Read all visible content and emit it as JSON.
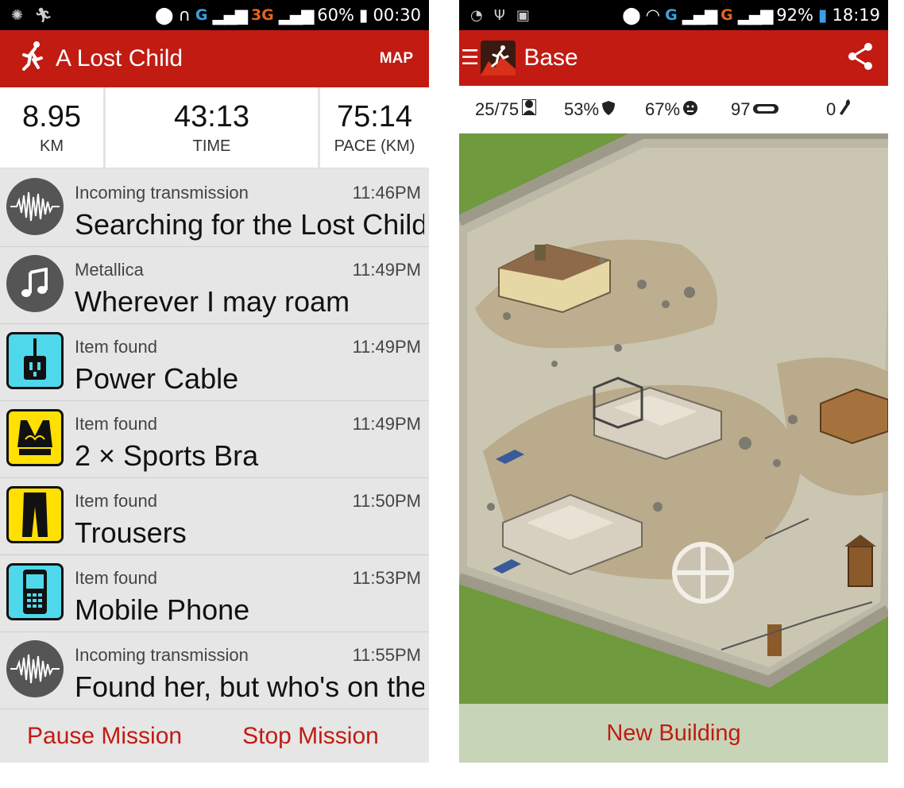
{
  "left": {
    "status": {
      "battery": "60%",
      "time": "00:30",
      "net1": "G",
      "net2": "3G"
    },
    "appbar": {
      "title": "A Lost Child",
      "map": "MAP"
    },
    "stats": [
      {
        "value": "8.95",
        "label": "KM"
      },
      {
        "value": "43:13",
        "label": "TIME"
      },
      {
        "value": "75:14",
        "label": "PACE (KM)"
      }
    ],
    "feed": [
      {
        "icon": "transmission-icon",
        "sub": "Incoming transmission",
        "time": "11:46PM",
        "main": "Searching for the Lost Child"
      },
      {
        "icon": "music-note-icon",
        "sub": "Metallica",
        "time": "11:49PM",
        "main": "Wherever I may roam"
      },
      {
        "icon": "power-cable-icon",
        "sub": "Item found",
        "time": "11:49PM",
        "main": "Power Cable"
      },
      {
        "icon": "sports-bra-icon",
        "sub": "Item found",
        "time": "11:49PM",
        "main": "2 × Sports Bra"
      },
      {
        "icon": "trousers-icon",
        "sub": "Item found",
        "time": "11:50PM",
        "main": "Trousers"
      },
      {
        "icon": "mobile-phone-icon",
        "sub": "Item found",
        "time": "11:53PM",
        "main": "Mobile Phone"
      },
      {
        "icon": "transmission-icon",
        "sub": "Incoming transmission",
        "time": "11:55PM",
        "main": "Found her, but who's on the"
      }
    ],
    "actions": {
      "pause": "Pause Mission",
      "stop": "Stop Mission"
    }
  },
  "right": {
    "status": {
      "battery": "92%",
      "time": "18:19",
      "net1": "G",
      "net2": "G"
    },
    "appbar": {
      "title": "Base"
    },
    "resources": {
      "survivors": "25/75",
      "defence": "53%",
      "happiness": "67%",
      "food": "97",
      "parts": "0"
    },
    "new_building": "New Building"
  },
  "colors": {
    "brand_red": "#c11b12",
    "feed_bg": "#e6e6e6",
    "item_cyan": "#4fd8ec",
    "item_yellow": "#ffe000"
  }
}
